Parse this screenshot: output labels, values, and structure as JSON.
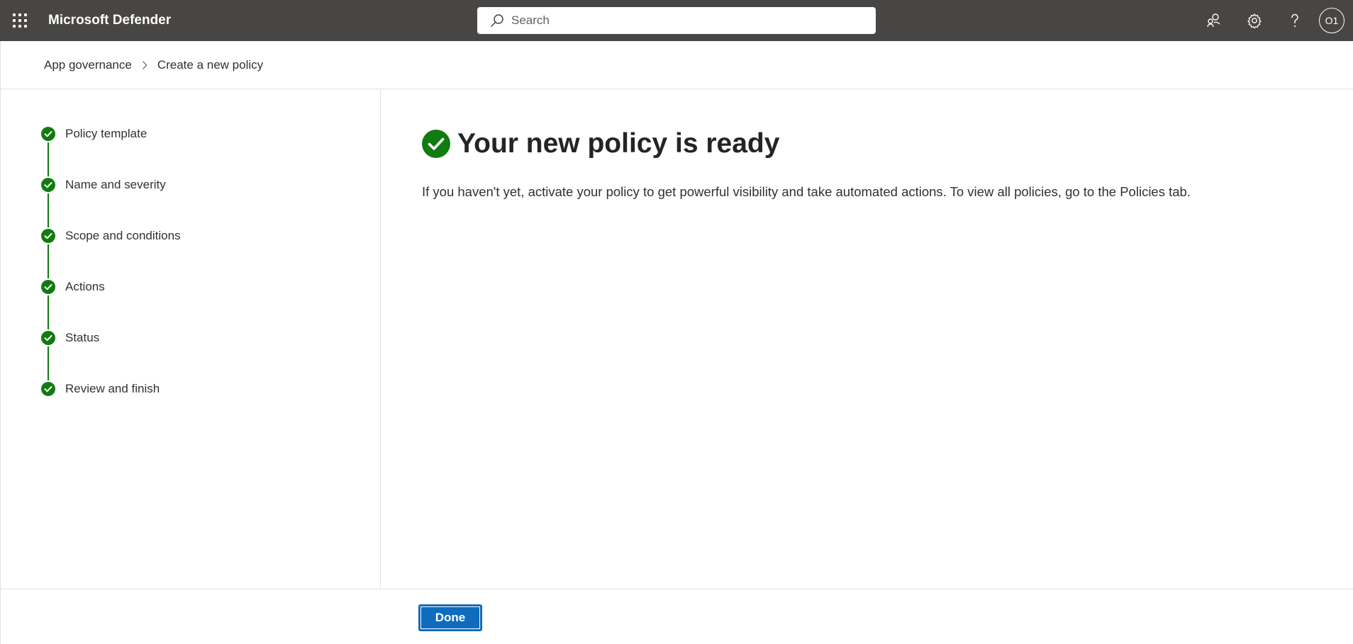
{
  "header": {
    "app_title": "Microsoft Defender",
    "search_placeholder": "Search",
    "avatar_initials": "O1",
    "bar_color": "#484644"
  },
  "breadcrumb": {
    "items": [
      "App governance",
      "Create a new policy"
    ]
  },
  "steps": [
    {
      "label": "Policy template",
      "state": "completed"
    },
    {
      "label": "Name and severity",
      "state": "completed"
    },
    {
      "label": "Scope and conditions",
      "state": "completed"
    },
    {
      "label": "Actions",
      "state": "completed"
    },
    {
      "label": "Status",
      "state": "completed"
    },
    {
      "label": "Review and finish",
      "state": "completed"
    }
  ],
  "main": {
    "title": "Your new policy is ready",
    "description": "If you haven't yet, activate your policy to get powerful visibility and take automated actions. To view all policies, go to the Policies tab.",
    "success_color": "#107c10"
  },
  "footer": {
    "done_label": "Done",
    "accent_color": "#0f6cbd"
  },
  "icons": [
    "app-launcher-icon",
    "search-icon",
    "community-icon",
    "gear-icon",
    "help-icon",
    "chevron-right-icon",
    "checkmark-circle-icon"
  ]
}
